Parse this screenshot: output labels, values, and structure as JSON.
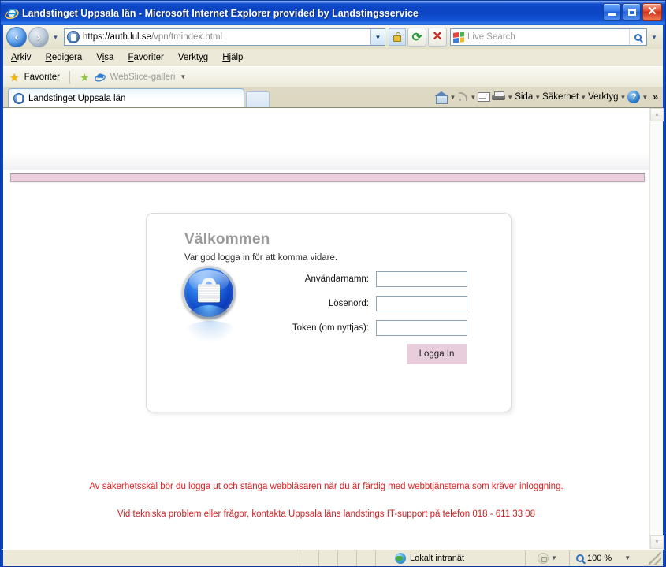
{
  "window": {
    "title": "Landstinget Uppsala län - Microsoft Internet Explorer provided by Landstingsservice",
    "minimize_label": "Minimera",
    "maximize_label": "Maximera",
    "close_label": "Stäng"
  },
  "navbar": {
    "back_label": "Tillbaka",
    "forward_label": "Framåt",
    "url_scheme": "https://",
    "url_host": "auth.lul.se",
    "url_path": "/vpn/tmindex.html",
    "url_full": "https://auth.lul.se/vpn/tmindex.html",
    "refresh_label": "Uppdatera",
    "stop_label": "Stoppa",
    "search_placeholder": "Live Search"
  },
  "menubar": {
    "items": [
      {
        "label": "Arkiv",
        "accel": "A"
      },
      {
        "label": "Redigera",
        "accel": "R"
      },
      {
        "label": "Visa",
        "accel": "i"
      },
      {
        "label": "Favoriter",
        "accel": "F"
      },
      {
        "label": "Verktyg",
        "accel": "y"
      },
      {
        "label": "Hjälp",
        "accel": "H"
      }
    ]
  },
  "favbar": {
    "favorites_label": "Favoriter",
    "webslice_label": "WebSlice-galleri"
  },
  "tabbar": {
    "active_tab_label": "Landstinget Uppsala län",
    "new_tab_label": "Ny flik",
    "tools": [
      {
        "name": "home",
        "label": ""
      },
      {
        "name": "feeds",
        "label": ""
      },
      {
        "name": "mail",
        "label": ""
      },
      {
        "name": "print",
        "label": ""
      },
      {
        "name": "page",
        "label": "Sida"
      },
      {
        "name": "safety",
        "label": "Säkerhet"
      },
      {
        "name": "tools",
        "label": "Verktyg"
      },
      {
        "name": "help",
        "label": ""
      }
    ],
    "overflow_label": "»"
  },
  "page": {
    "login_card": {
      "heading": "Välkommen",
      "subheading": "Var god logga in för att komma vidare.",
      "fields": [
        {
          "label": "Användarnamn:",
          "value": "",
          "placeholder": ""
        },
        {
          "label": "Lösenord:",
          "value": "",
          "placeholder": ""
        },
        {
          "label": "Token (om nyttjas):",
          "value": "",
          "placeholder": ""
        }
      ],
      "submit_label": "Logga In"
    },
    "warning_text": "Av säkerhetsskäl bör du logga ut och stänga webbläsaren när du är färdig med webbtjänsterna som kräver inloggning.",
    "support_text": "Vid tekniska problem eller frågor, kontakta Uppsala läns landstings IT-support på telefon 018 - 611 33 08"
  },
  "statusbar": {
    "zone_label": "Lokalt intranät",
    "zoom_label": "100 %"
  },
  "colors": {
    "title_blue": "#0b45c4",
    "pink_bar": "#eccfdf",
    "button_pink": "#e8cddc",
    "warning_red": "#dd2222",
    "heading_gray": "#9a9a9a"
  }
}
